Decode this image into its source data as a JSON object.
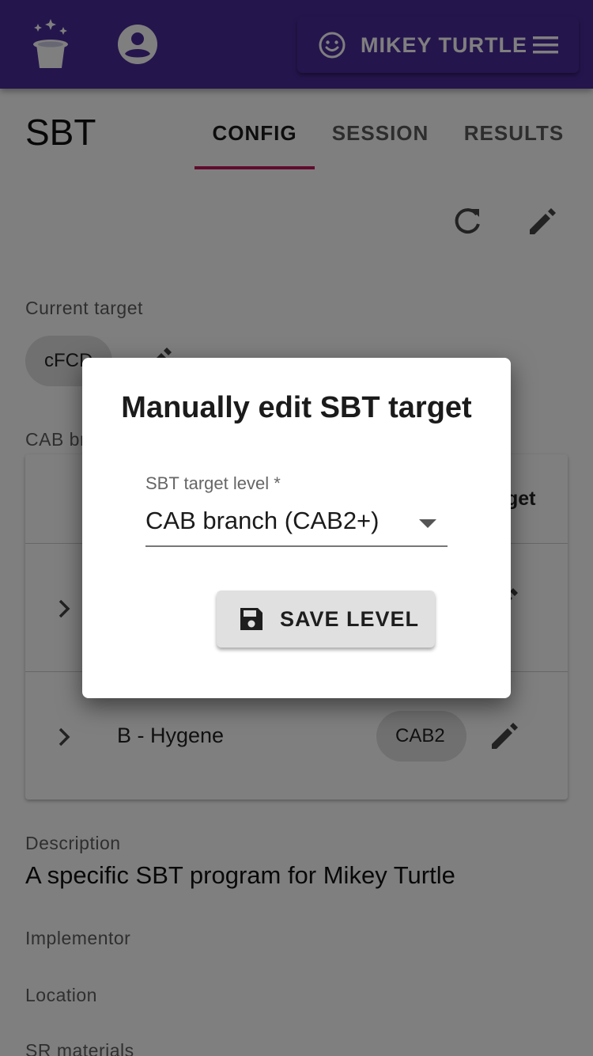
{
  "app_bar": {
    "logo": "magic-hat-icon",
    "account": "account-circle-icon",
    "user_menu": {
      "icon": "smile-icon",
      "name": "MIKEY TURTLE",
      "menu_icon": "hamburger-menu-icon"
    }
  },
  "page": {
    "title": "SBT"
  },
  "tabs": [
    {
      "label": "CONFIG",
      "active": true
    },
    {
      "label": "SESSION",
      "active": false
    },
    {
      "label": "RESULTS",
      "active": false
    }
  ],
  "toolbar": {
    "refresh_icon": "refresh-icon",
    "edit_icon": "pencil-icon"
  },
  "current_target": {
    "label": "Current target",
    "value": "cFCD"
  },
  "cab_section": {
    "label": "CAB br"
  },
  "cab_table": {
    "header_target": "get",
    "rows": [
      {
        "name": "",
        "target": ""
      },
      {
        "name": "B - Hygene",
        "target": "CAB2"
      }
    ]
  },
  "description": {
    "label": "Description",
    "text": "A specific SBT program for Mikey Turtle"
  },
  "implementor": {
    "label": "Implementor"
  },
  "location": {
    "label": "Location"
  },
  "sr_materials": {
    "label": "SR materials"
  },
  "dialog": {
    "title": "Manually edit SBT target",
    "select_label": "SBT target level *",
    "select_value": "CAB branch (CAB2+)",
    "save_label": "SAVE LEVEL",
    "save_icon": "floppy-disk-icon"
  },
  "colors": {
    "app_bar": "#4a2a9a",
    "tab_indicator": "#c2185b",
    "chip": "#e0e0e0"
  }
}
